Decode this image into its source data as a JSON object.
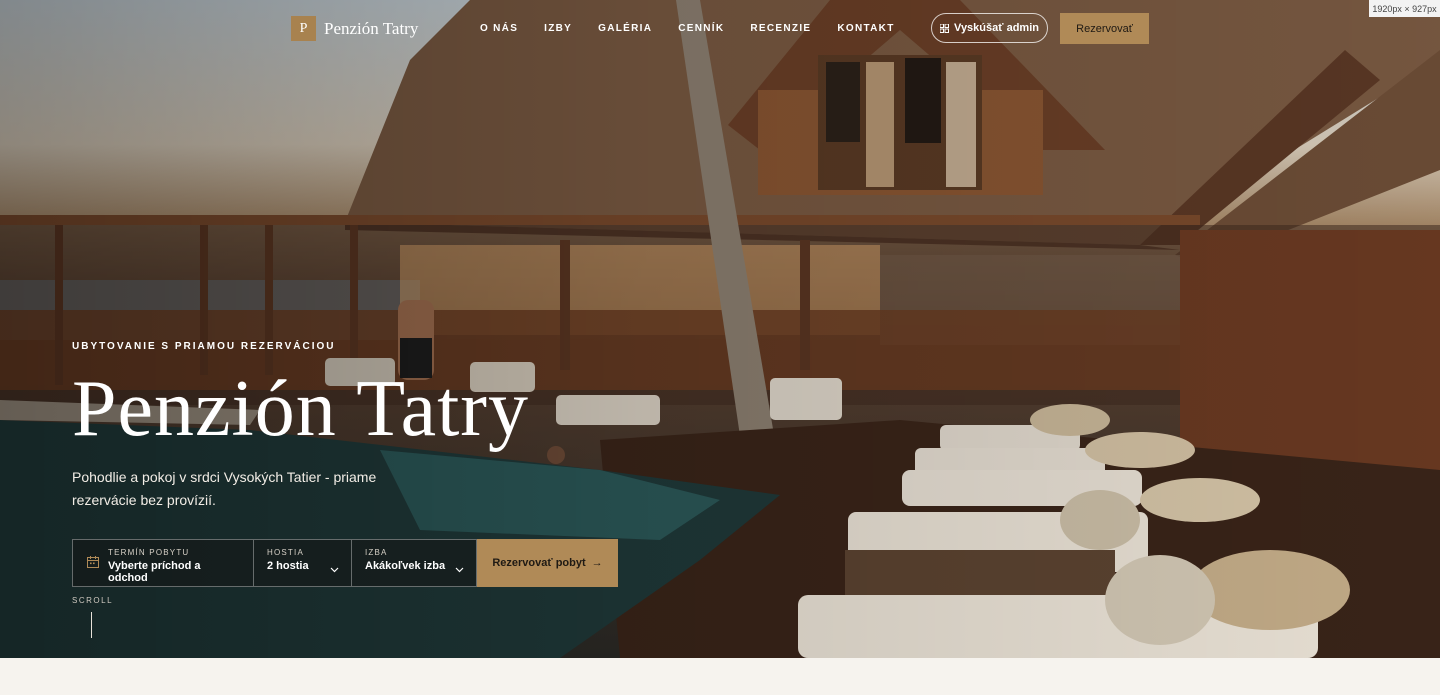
{
  "brand": {
    "logo_letter": "P",
    "name": "Penzión Tatry",
    "accent": "#b08a57"
  },
  "nav": {
    "items": [
      "O NÁS",
      "IZBY",
      "GALÉRIA",
      "CENNÍK",
      "RECENZIE",
      "KONTAKT"
    ]
  },
  "header": {
    "admin_label": "Vyskúšať admin",
    "reserve_label": "Rezervovať"
  },
  "hero": {
    "eyebrow": "UBYTOVANIE S PRIAMOU REZERVÁCIOU",
    "title": "Penzión Tatry",
    "subtitle": "Pohodlie a pokoj v srdci Vysokých Tatier - priame rezervácie bez provízií."
  },
  "booking": {
    "date_label": "TERMÍN POBYTU",
    "date_value": "Vyberte príchod a odchod",
    "guests_label": "HOSTIA",
    "guests_value": "2 hostia",
    "room_label": "IZBA",
    "room_value": "Akákoľvek izba",
    "submit_label": "Rezervovať pobyt",
    "submit_arrow": "→"
  },
  "scroll_label": "SCROLL",
  "viewport_badge": "1920px × 927px",
  "icons": {
    "calendar": "calendar-icon",
    "chevron": "chevron-down-icon",
    "grid": "grid-icon",
    "arrow": "arrow-right-icon"
  }
}
